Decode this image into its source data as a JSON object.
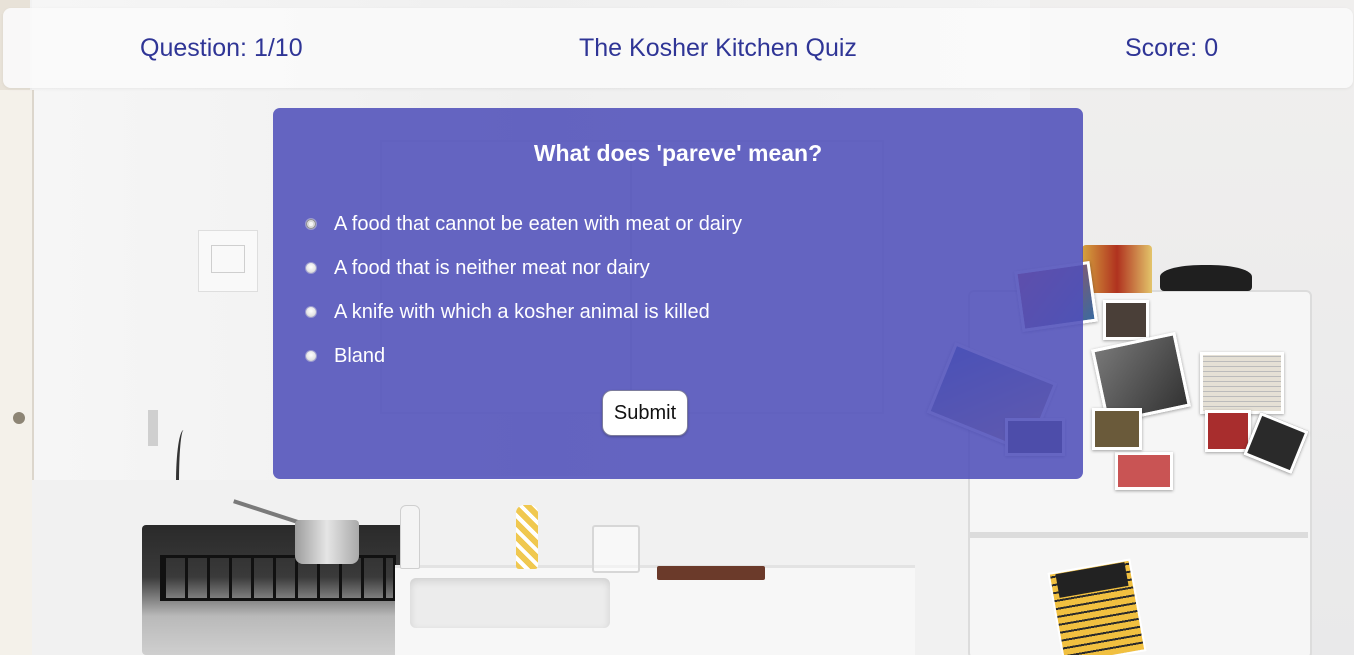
{
  "header": {
    "question_counter": "Question: 1/10",
    "title": "The Kosher Kitchen Quiz",
    "score": "Score: 0"
  },
  "quiz": {
    "question": "What does 'pareve' mean?",
    "answers": [
      {
        "label": "A food that cannot be eaten with meat or dairy"
      },
      {
        "label": "A food that is neither meat nor dairy"
      },
      {
        "label": "A knife with which a kosher animal is killed"
      },
      {
        "label": "Bland"
      }
    ],
    "submit_label": "Submit"
  },
  "colors": {
    "header_text": "#2f3596",
    "card_background": "#5050b9",
    "card_text": "#ffffff"
  }
}
